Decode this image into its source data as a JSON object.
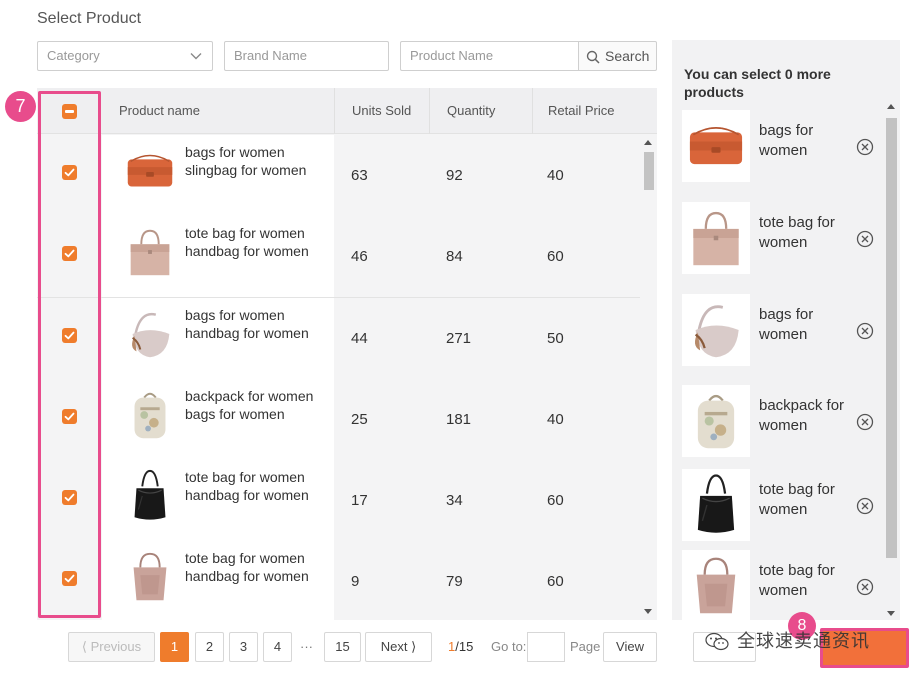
{
  "page_title": "Select Product",
  "filters": {
    "category_placeholder": "Category",
    "brand_placeholder": "Brand Name",
    "product_placeholder": "Product Name",
    "search_label": "Search"
  },
  "table": {
    "columns": [
      "Product name",
      "Units Sold",
      "Quantity",
      "Retail Price"
    ],
    "header_checkbox_state": "indeterminate",
    "rows": [
      {
        "name": "bags for women slingbag for women",
        "units_sold": "63",
        "quantity": "92",
        "retail_price": "40",
        "checked": true,
        "image": "orange-crossbody-bag"
      },
      {
        "name": "tote bag for women handbag for women",
        "units_sold": "46",
        "quantity": "84",
        "retail_price": "60",
        "checked": true,
        "image": "pink-tote-bag"
      },
      {
        "name": "bags for women handbag for women",
        "units_sold": "44",
        "quantity": "271",
        "retail_price": "50",
        "checked": true,
        "image": "hobo-bag-scarf"
      },
      {
        "name": "backpack for women bags for women",
        "units_sold": "25",
        "quantity": "181",
        "retail_price": "40",
        "checked": true,
        "image": "floral-backpack"
      },
      {
        "name": "tote bag for women handbag for women",
        "units_sold": "17",
        "quantity": "34",
        "retail_price": "60",
        "checked": true,
        "image": "black-bucket-bag"
      },
      {
        "name": "tote bag for women handbag for women",
        "units_sold": "9",
        "quantity": "79",
        "retail_price": "60",
        "checked": true,
        "image": "rose-tote-bag"
      }
    ]
  },
  "side_panel": {
    "title": "You can select 0 more products",
    "items": [
      {
        "name": "bags for women",
        "image": "orange-crossbody-bag"
      },
      {
        "name": "tote bag for women",
        "image": "pink-tote-bag"
      },
      {
        "name": "bags for women",
        "image": "hobo-bag-scarf"
      },
      {
        "name": "backpack for women",
        "image": "floral-backpack"
      },
      {
        "name": "tote bag for women",
        "image": "black-bucket-bag"
      },
      {
        "name": "tote bag for women",
        "image": "rose-tote-bag"
      }
    ]
  },
  "pagination": {
    "previous_label": "Previous",
    "pages": [
      "1",
      "2",
      "3",
      "4"
    ],
    "ellipsis": "···",
    "last_page": "15",
    "next_label": "Next",
    "current": "1",
    "total": "/15",
    "goto_label": "Go to:",
    "page_label": "Page",
    "view_label": "View"
  },
  "annotations": {
    "badge_left": "7",
    "badge_right": "8"
  },
  "watermark": "全球速卖通资讯",
  "colors": {
    "accent": "#ef7c2c",
    "highlight": "#e84c8c"
  }
}
